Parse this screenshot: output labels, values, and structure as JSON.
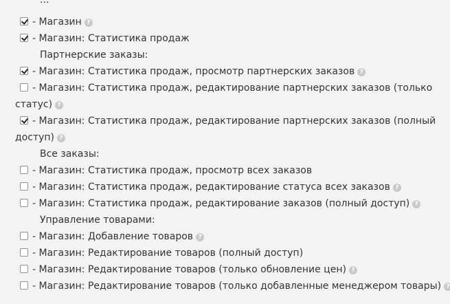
{
  "top_partial": "...",
  "rows": [
    {
      "type": "check",
      "checked": true,
      "label": "- Магазин",
      "help": true
    },
    {
      "type": "check",
      "checked": true,
      "label": "- Магазин: Статистика продаж",
      "help": false
    },
    {
      "type": "heading",
      "label": "Партнерские заказы:"
    },
    {
      "type": "check",
      "checked": true,
      "label": "- Магазин: Статистика продаж, просмотр партнерских заказов",
      "help": true
    },
    {
      "type": "check",
      "checked": false,
      "label": "- Магазин: Статистика продаж, редактирование партнерских заказов (только",
      "label2": "статус)",
      "help": true
    },
    {
      "type": "check",
      "checked": true,
      "label": "- Магазин: Статистика продаж, редактирование партнерских заказов (полный",
      "label2": "доступ)",
      "help": true
    },
    {
      "type": "heading",
      "label": "Все заказы:"
    },
    {
      "type": "check",
      "checked": false,
      "label": "- Магазин: Статистика продаж, просмотр всех заказов",
      "help": false
    },
    {
      "type": "check",
      "checked": false,
      "label": "- Магазин: Статистика продаж, редактирование статуса всех заказов",
      "help": true
    },
    {
      "type": "check",
      "checked": false,
      "label": "- Магазин: Статистика продаж, редактирование заказов (полный доступ)",
      "help": true
    },
    {
      "type": "heading",
      "label": "Управление товарами:"
    },
    {
      "type": "check",
      "checked": false,
      "label": "- Магазин: Добавление товаров",
      "help": true
    },
    {
      "type": "check",
      "checked": false,
      "label": "- Магазин: Редактирование товаров (полный доступ)",
      "help": false
    },
    {
      "type": "check",
      "checked": false,
      "label": "- Магазин: Редактирование товаров (только обновление цен)",
      "help": true
    },
    {
      "type": "check",
      "checked": false,
      "label": "- Магазин: Редактирование товаров (только добавленные менеджером товары)",
      "help": true
    }
  ]
}
